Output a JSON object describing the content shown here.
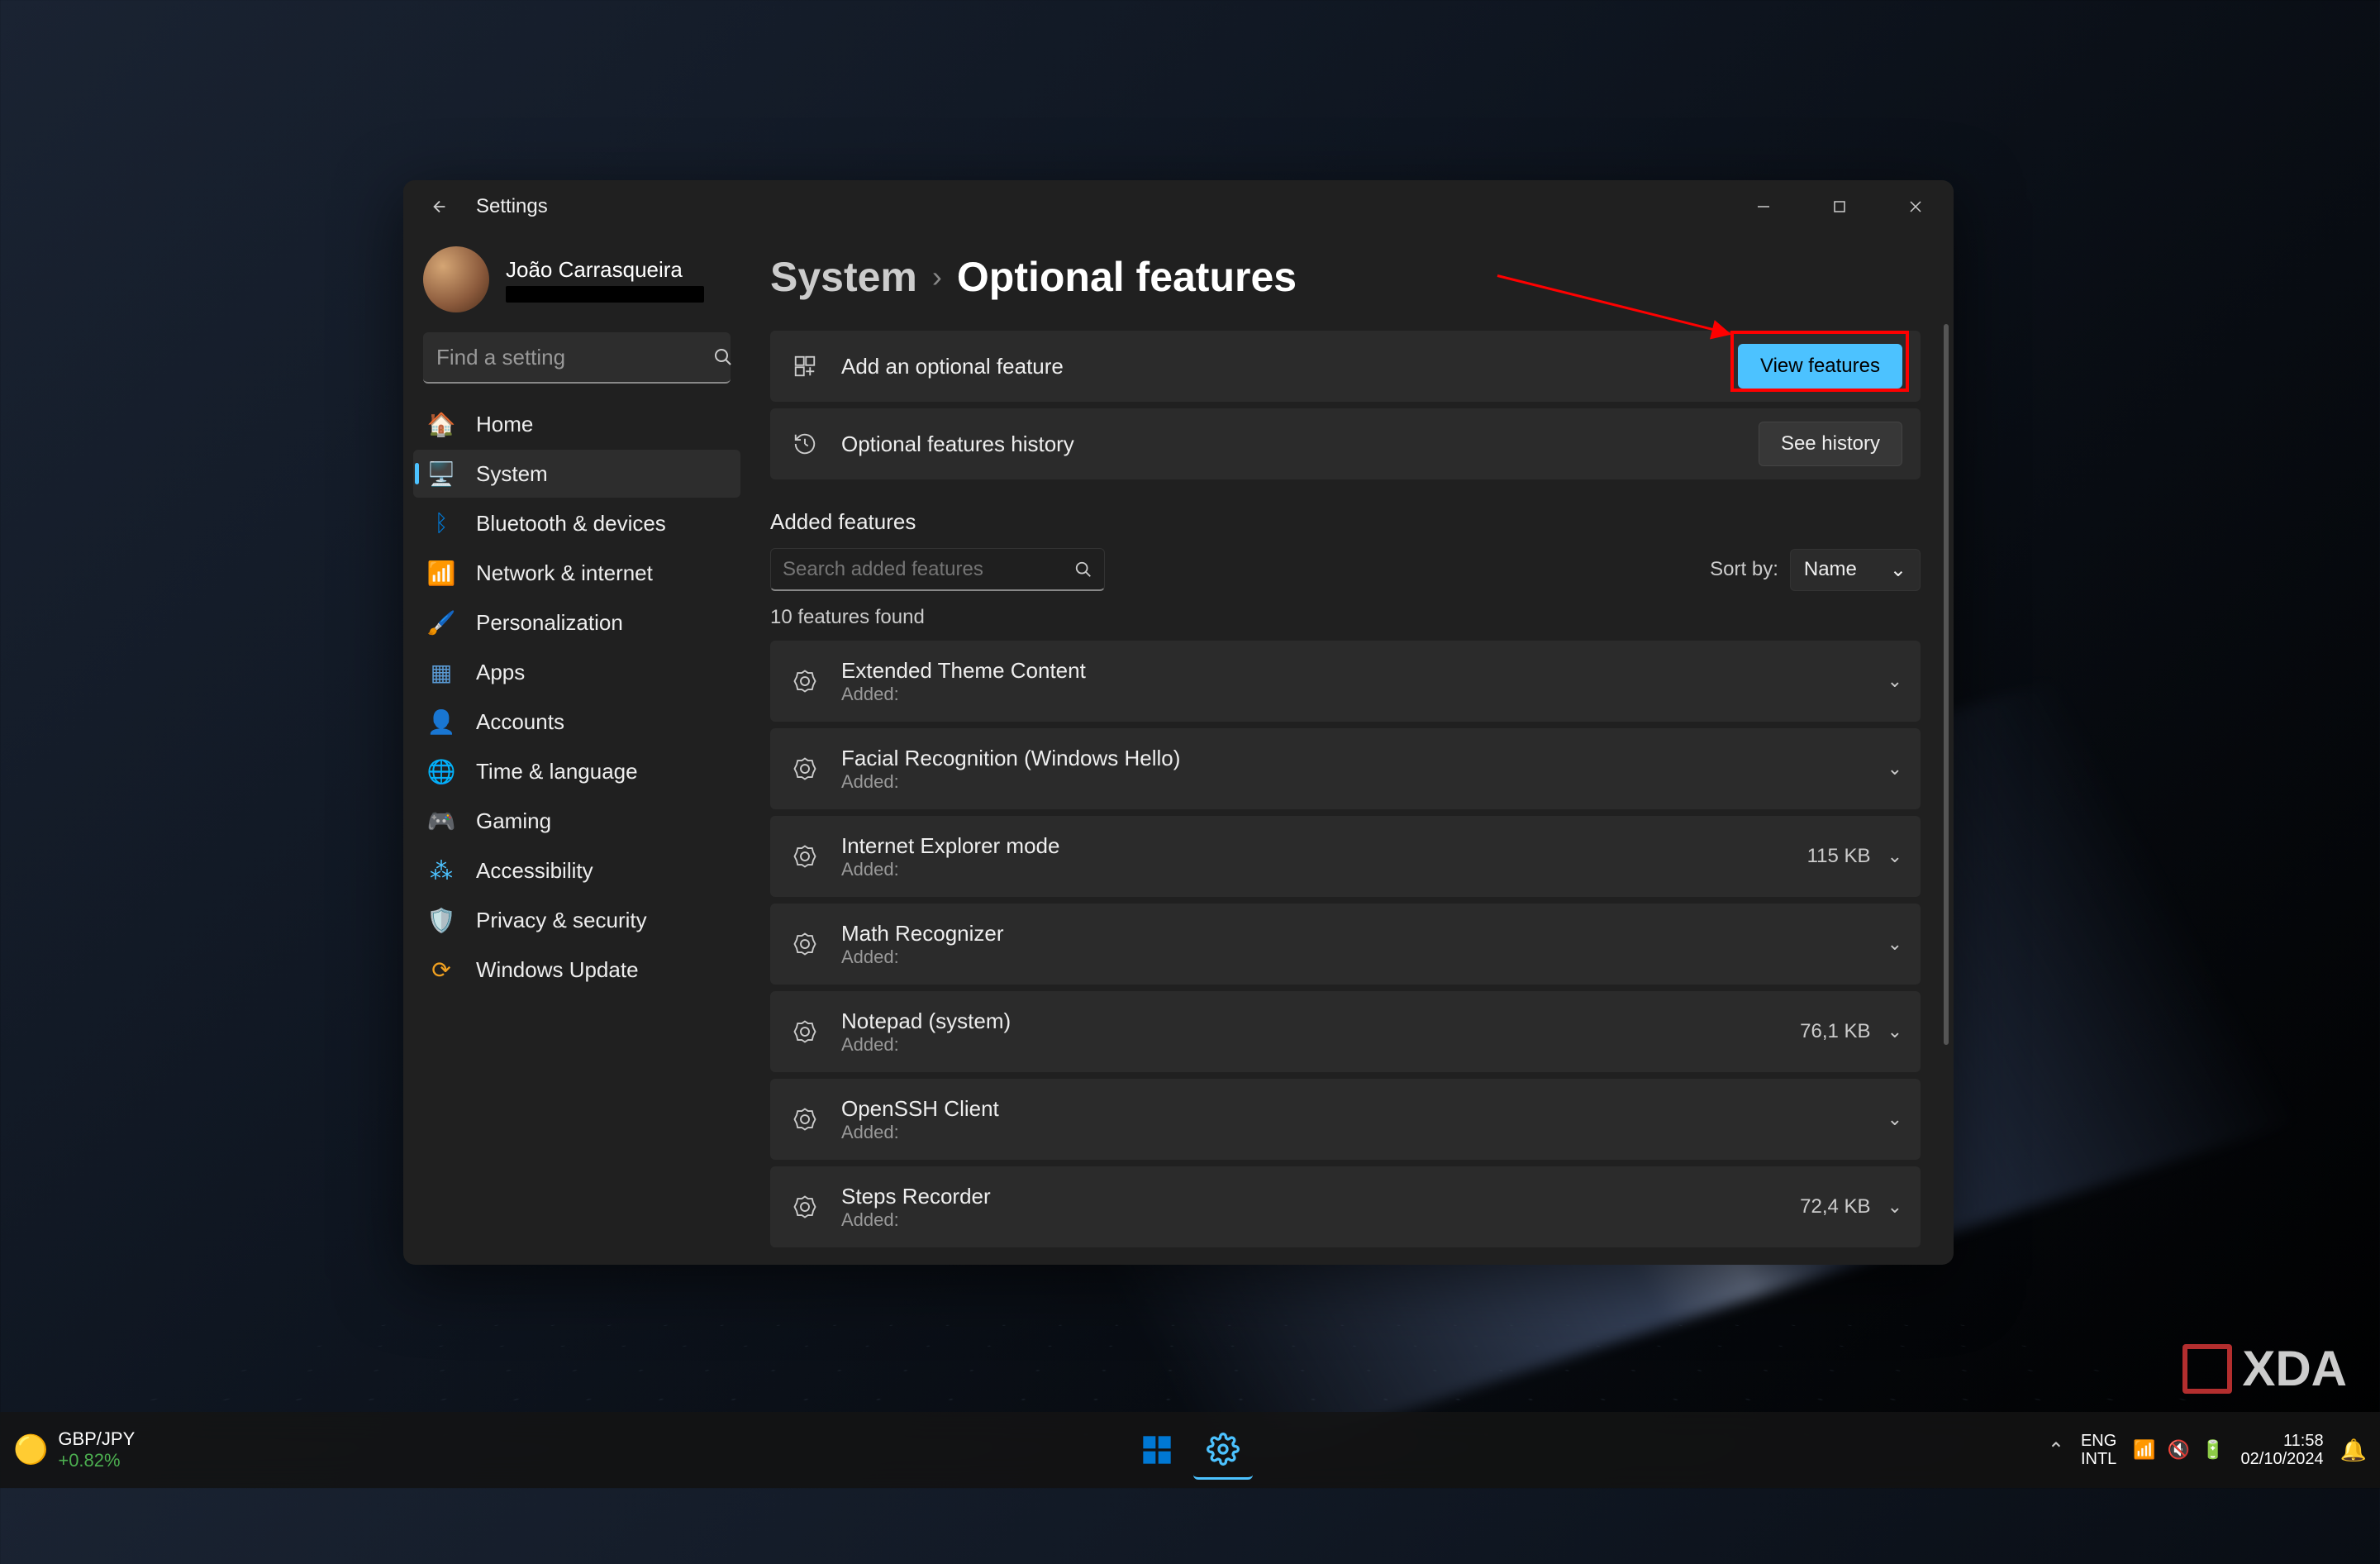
{
  "window": {
    "title": "Settings",
    "breadcrumb": {
      "parent": "System",
      "current": "Optional features"
    }
  },
  "profile": {
    "name": "João Carrasqueira"
  },
  "search": {
    "placeholder": "Find a setting"
  },
  "nav": [
    {
      "icon": "🏠",
      "label": "Home"
    },
    {
      "icon": "🖥️",
      "label": "System"
    },
    {
      "icon": "ᛒ",
      "label": "Bluetooth & devices",
      "iconColor": "#0078d4"
    },
    {
      "icon": "📶",
      "label": "Network & internet",
      "iconColor": "#3aa0e0"
    },
    {
      "icon": "🖌️",
      "label": "Personalization"
    },
    {
      "icon": "▦",
      "label": "Apps",
      "iconColor": "#5a9ad4"
    },
    {
      "icon": "👤",
      "label": "Accounts",
      "iconColor": "#4aa564"
    },
    {
      "icon": "🌐",
      "label": "Time & language",
      "iconColor": "#5a9ad4"
    },
    {
      "icon": "🎮",
      "label": "Gaming"
    },
    {
      "icon": "⁂",
      "label": "Accessibility",
      "iconColor": "#4cc2ff"
    },
    {
      "icon": "🛡️",
      "label": "Privacy & security"
    },
    {
      "icon": "⟳",
      "label": "Windows Update",
      "iconColor": "#f0a020"
    }
  ],
  "activeNavIndex": 1,
  "cards": {
    "add": {
      "label": "Add an optional feature",
      "button": "View features"
    },
    "history": {
      "label": "Optional features history",
      "button": "See history"
    }
  },
  "added": {
    "section_title": "Added features",
    "search_placeholder": "Search added features",
    "sort_label": "Sort by:",
    "sort_value": "Name",
    "count_label": "10 features found",
    "items": [
      {
        "name": "Extended Theme Content",
        "sub": "Added:",
        "size": ""
      },
      {
        "name": "Facial Recognition (Windows Hello)",
        "sub": "Added:",
        "size": ""
      },
      {
        "name": "Internet Explorer mode",
        "sub": "Added:",
        "size": "115 KB"
      },
      {
        "name": "Math Recognizer",
        "sub": "Added:",
        "size": ""
      },
      {
        "name": "Notepad (system)",
        "sub": "Added:",
        "size": "76,1 KB"
      },
      {
        "name": "OpenSSH Client",
        "sub": "Added:",
        "size": ""
      },
      {
        "name": "Steps Recorder",
        "sub": "Added:",
        "size": "72,4 KB"
      }
    ]
  },
  "taskbar": {
    "widget": {
      "line1": "GBP/JPY",
      "line2": "+0.82%"
    },
    "lang": {
      "l1": "ENG",
      "l2": "INTL"
    },
    "time": "11:58",
    "date": "02/10/2024"
  },
  "watermark": "XDA"
}
